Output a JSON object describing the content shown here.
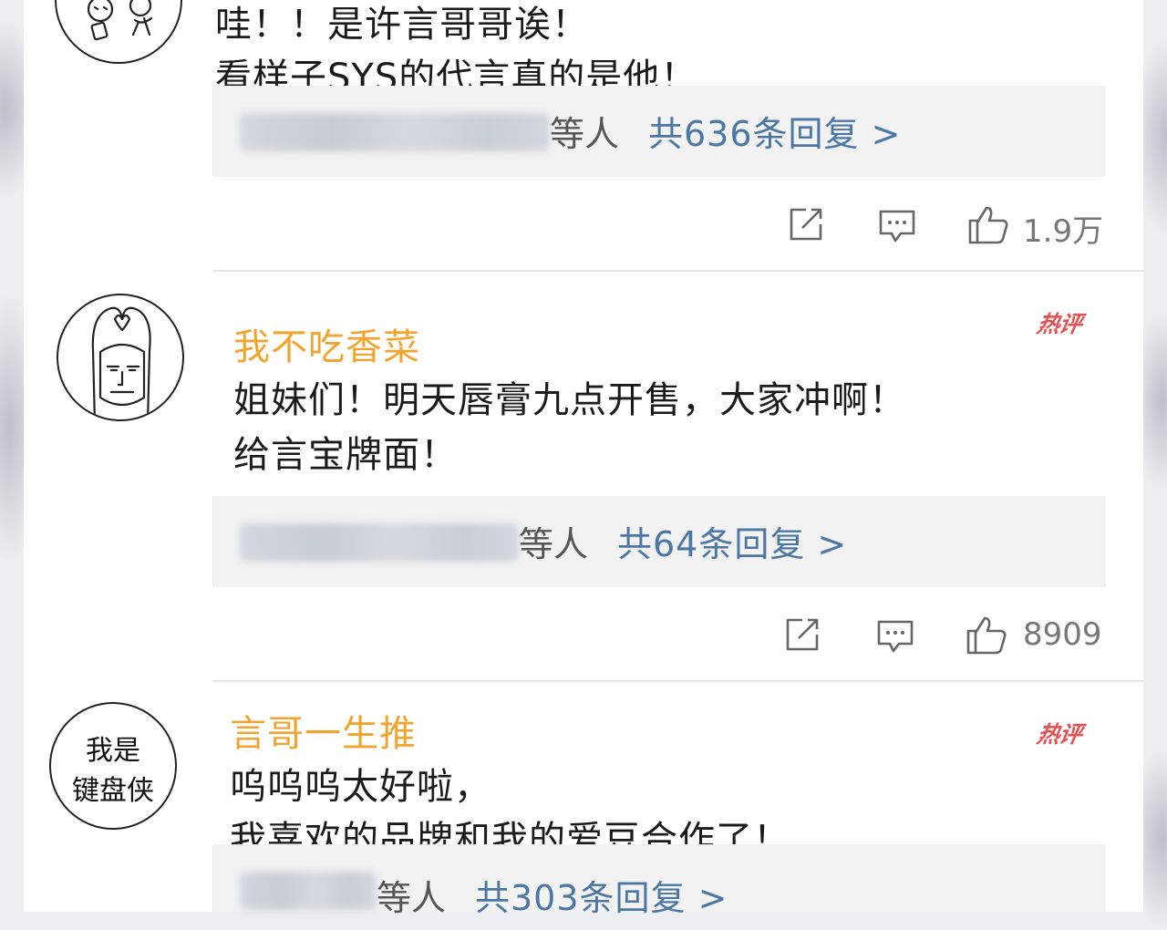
{
  "comments": [
    {
      "username": "",
      "lines": [
        "哇！！是许言哥哥诶！",
        "看样子SYS的代言真的是他！"
      ],
      "hot_badge": "",
      "reply": {
        "etc": "等人",
        "total": "共636条回复 >"
      },
      "likes": "1.9万",
      "avatar_icon": "meme-doodle-avatar"
    },
    {
      "username": "我不吃香菜",
      "lines": [
        "姐妹们！明天唇膏九点开售，大家冲啊！",
        "给言宝牌面！"
      ],
      "hot_badge": "热评",
      "reply": {
        "etc": "等人",
        "total": "共64条回复 >"
      },
      "likes": "8909",
      "avatar_icon": "meme-face-heart-avatar"
    },
    {
      "username": "言哥一生推",
      "lines": [
        "呜呜呜太好啦，",
        "我喜欢的品牌和我的爱豆合作了！"
      ],
      "hot_badge": "热评",
      "reply": {
        "etc": "等人",
        "total": "共303条回复 >"
      },
      "likes": "",
      "avatar_text": [
        "我是",
        "键盘侠"
      ]
    }
  ],
  "icons": {
    "share": "share-icon",
    "comment": "comment-icon",
    "like": "thumbs-up-icon"
  },
  "colors": {
    "username": "#f2a42f",
    "reply_link": "#4c76a4",
    "hot_badge": "#e25252",
    "text": "#1b1b1b"
  }
}
